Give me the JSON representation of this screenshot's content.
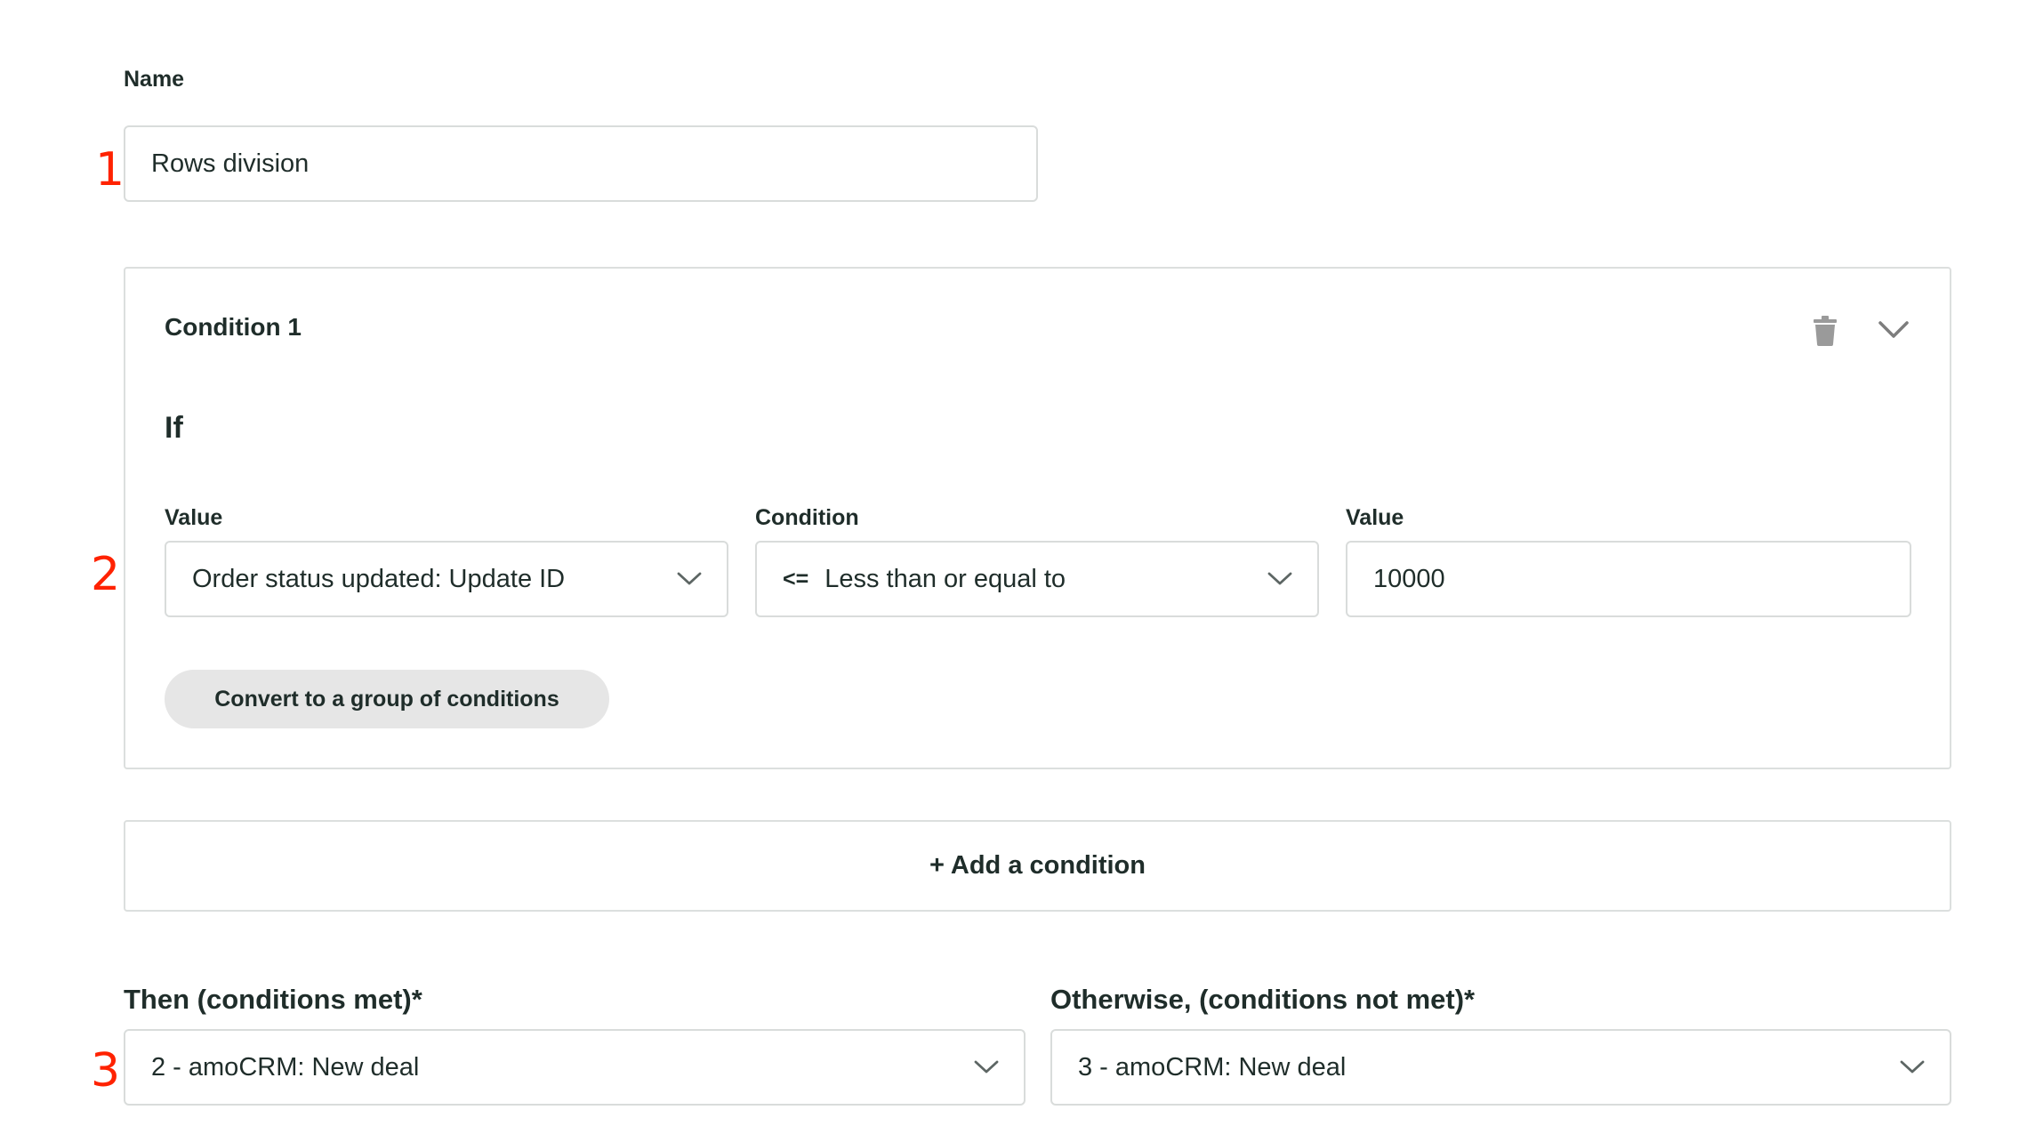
{
  "name_section": {
    "label": "Name",
    "value": "Rows division",
    "marker": "1"
  },
  "condition_card": {
    "title": "Condition 1",
    "if_label": "If",
    "marker": "2",
    "delete_icon": "trash-icon",
    "collapse_icon": "chevron-down-icon",
    "value_left": {
      "label": "Value",
      "selected": "Order status updated: Update ID"
    },
    "condition": {
      "label": "Condition",
      "operator": "<=",
      "selected": "Less than or equal to"
    },
    "value_right": {
      "label": "Value",
      "value": "10000"
    },
    "convert_button": "Convert to a group of conditions"
  },
  "add_condition_button": "+ Add a condition",
  "then_section": {
    "label": "Then (conditions met)*",
    "selected": "2 - amoCRM: New deal",
    "marker": "3"
  },
  "otherwise_section": {
    "label": "Otherwise, (conditions not met)*",
    "selected": "3 - amoCRM: New deal"
  },
  "colors": {
    "text": "#1f2d2a",
    "border": "#d9dcdb",
    "marker": "#ff2200",
    "pill_bg": "#e6e6e6",
    "icon": "#9a9a9a"
  }
}
